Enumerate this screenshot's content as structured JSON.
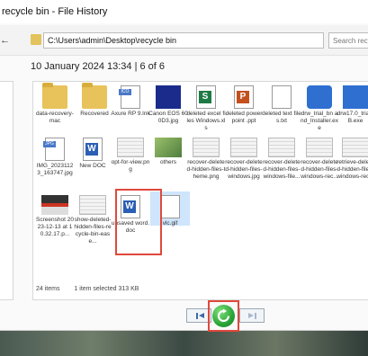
{
  "window": {
    "title": "recycle bin - File History"
  },
  "toolbar": {
    "back_glyph": "←",
    "address": "C:\\Users\\admin\\Desktop\\recycle bin",
    "search_placeholder": "Search recycle b"
  },
  "header": {
    "date_label": "10 January 2024 13:34 | 6 of 6"
  },
  "files": [
    {
      "label": "data-recovery-mac",
      "icon": "folder-icon"
    },
    {
      "label": "Recovered",
      "icon": "folder-icon"
    },
    {
      "label": "Axure RP 9.lnk",
      "icon": "image-file-icon",
      "tag": "ICO"
    },
    {
      "label": "Canon EOS 600D3.jpg",
      "icon": "photo-icon"
    },
    {
      "label": "deleted excel files Windows.xls",
      "icon": "excel-icon",
      "tag": "S"
    },
    {
      "label": "deleted powerpoint .ppt",
      "icon": "powerpoint-icon",
      "tag": "P"
    },
    {
      "label": "deleted text files.txt",
      "icon": "text-file-icon"
    },
    {
      "label": "drw_trial_bn and_Installer.exe",
      "icon": "installer-icon"
    },
    {
      "label": "drw17.0_trial_B.exe",
      "icon": "installer-icon"
    },
    {
      "label": "IMG_20231123_163747.jpg",
      "icon": "image-file-icon",
      "tag": "JPG"
    },
    {
      "label": "New DOC",
      "icon": "word-icon",
      "tag": "W"
    },
    {
      "label": "opt-for-view.png",
      "icon": "screenshot-thumb-icon"
    },
    {
      "label": "others",
      "icon": "photo-thumb-icon"
    },
    {
      "label": "recover-deleted-hidden-files-theme.png",
      "icon": "screenshot-thumb-icon"
    },
    {
      "label": "recover-deleted-hidden-files-windows.jpg",
      "icon": "screenshot-thumb-icon"
    },
    {
      "label": "recover-deleted-hidden-files-windows-file...",
      "icon": "screenshot-thumb-icon"
    },
    {
      "label": "recover-deleted-hidden-files-windows-rec...",
      "icon": "screenshot-thumb-icon"
    },
    {
      "label": "retrieve-deleted-hidden-files-windows-rec...",
      "icon": "screenshot-thumb-icon"
    },
    {
      "label": "Screenshot 2023-12-13 at 10.32.17.p...",
      "icon": "screenshot-thumb-icon"
    },
    {
      "label": "show-deleted-hidden-files-recycle-bin-ease...",
      "icon": "screenshot-thumb-icon"
    },
    {
      "label": "unsaved word.doc",
      "icon": "word-icon",
      "tag": "W"
    },
    {
      "label": "vlc.gif",
      "icon": "gif-file-icon",
      "selected": true
    }
  ],
  "status": {
    "items_count": "24 items",
    "selection": "1 item selected 313 KB"
  },
  "colors": {
    "highlight_frame": "#e0483b",
    "selection": "#cfe5fb",
    "restore_green": "#2aa537"
  }
}
